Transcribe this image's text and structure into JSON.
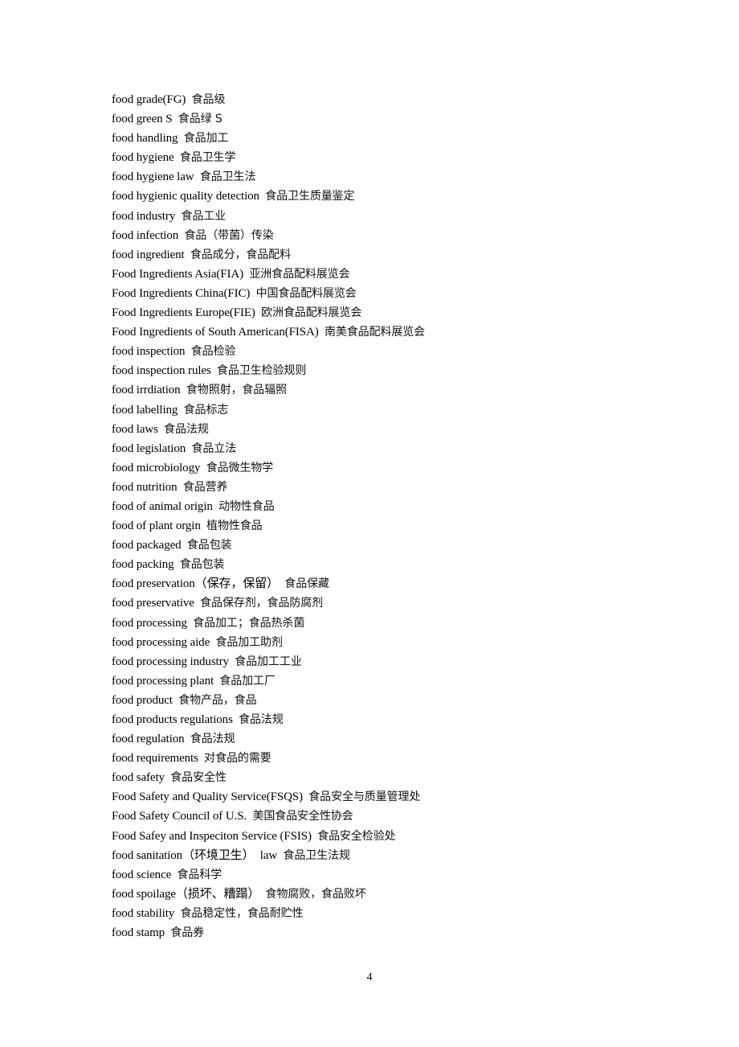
{
  "document": {
    "entries": [
      {
        "en": "food grade(FG)",
        "zh": "食品级"
      },
      {
        "en": "food green S",
        "zh": "食品绿 S"
      },
      {
        "en": "food handling",
        "zh": "食品加工"
      },
      {
        "en": "food hygiene",
        "zh": "食品卫生学"
      },
      {
        "en": "food hygiene law",
        "zh": "食品卫生法"
      },
      {
        "en": "food hygienic quality detection",
        "zh": "食品卫生质量鉴定"
      },
      {
        "en": "food industry",
        "zh": "食品工业"
      },
      {
        "en": "food infection",
        "zh": "食品（带菌）传染"
      },
      {
        "en": "food ingredient",
        "zh": "食品成分，食品配料"
      },
      {
        "en": "Food Ingredients Asia(FIA)",
        "zh": "亚洲食品配料展览会"
      },
      {
        "en": "Food Ingredients China(FIC)",
        "zh": "中国食品配料展览会"
      },
      {
        "en": "Food Ingredients Europe(FIE)",
        "zh": "欧洲食品配料展览会"
      },
      {
        "en": "Food Ingredients of South American(FISA)",
        "zh": "南美食品配料展览会"
      },
      {
        "en": "food inspection",
        "zh": "食品检验"
      },
      {
        "en": "food inspection rules",
        "zh": "食品卫生检验规则"
      },
      {
        "en": "food irrdiation",
        "zh": "食物照射，食品辐照"
      },
      {
        "en": "food labelling",
        "zh": "食品标志"
      },
      {
        "en": "food laws",
        "zh": "食品法规"
      },
      {
        "en": "food legislation",
        "zh": "食品立法"
      },
      {
        "en": "food microbiology",
        "zh": "食品微生物学"
      },
      {
        "en": "food nutrition",
        "zh": "食品营养"
      },
      {
        "en": "food of animal origin",
        "zh": "动物性食品"
      },
      {
        "en": "food of plant orgin",
        "zh": "植物性食品"
      },
      {
        "en": "food packaged",
        "zh": "食品包装"
      },
      {
        "en": "food packing",
        "zh": "食品包装"
      },
      {
        "en": "food preservation（保存，保留）",
        "zh": "食品保藏"
      },
      {
        "en": "food preservative",
        "zh": "食品保存剂，食品防腐剂"
      },
      {
        "en": "food processing",
        "zh": "食品加工；食品热杀菌"
      },
      {
        "en": "food processing aide",
        "zh": "食品加工助剂"
      },
      {
        "en": "food processing industry",
        "zh": "食品加工工业"
      },
      {
        "en": "food processing plant",
        "zh": "食品加工厂"
      },
      {
        "en": "food product",
        "zh": "食物产品，食品"
      },
      {
        "en": "food products regulations",
        "zh": "食品法规"
      },
      {
        "en": "food regulation",
        "zh": "食品法规"
      },
      {
        "en": "food requirements",
        "zh": "对食品的需要"
      },
      {
        "en": "food safety",
        "zh": "食品安全性"
      },
      {
        "en": "Food Safety and Quality Service(FSQS)",
        "zh": "食品安全与质量管理处"
      },
      {
        "en": "Food Safety Council of U.S.",
        "zh": "美国食品安全性协会"
      },
      {
        "en": "Food Safey and Inspeciton Service (FSIS)",
        "zh": "食品安全检验处"
      },
      {
        "en": "food sanitation（环境卫生）  law",
        "zh": "食品卫生法规"
      },
      {
        "en": "food science",
        "zh": "食品科学"
      },
      {
        "en": "food spoilage（损坏、糟蹋）",
        "zh": "食物腐败，食品败坏"
      },
      {
        "en": "food stability",
        "zh": "食品稳定性，食品耐贮性"
      },
      {
        "en": "food stamp",
        "zh": "食品券"
      }
    ],
    "page_number": "4"
  }
}
